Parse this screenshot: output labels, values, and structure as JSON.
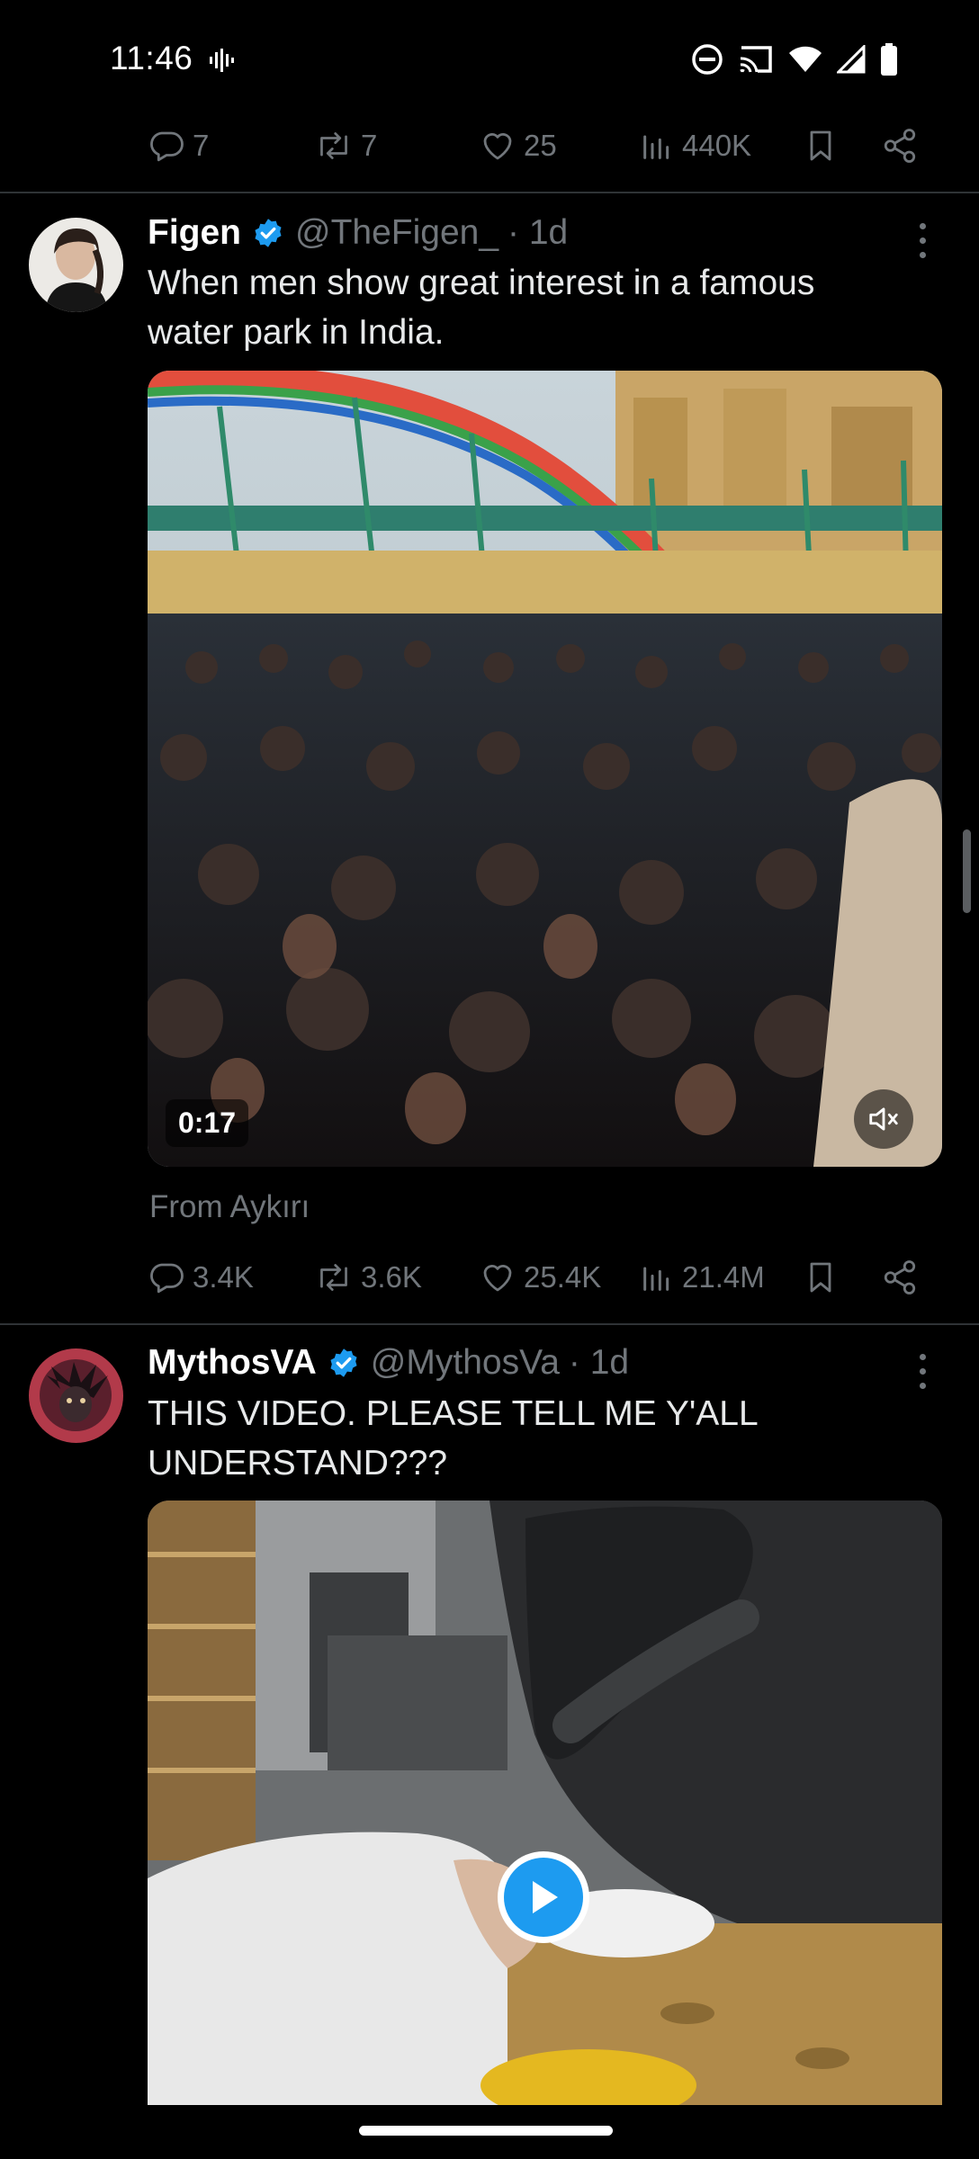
{
  "status_bar": {
    "time": "11:46",
    "icons": [
      "voicemail-wave-icon",
      "dnd-icon",
      "cast-icon",
      "wifi-icon",
      "signal-icon",
      "battery-icon"
    ]
  },
  "top_actions": {
    "replies": "7",
    "reposts": "7",
    "likes": "25",
    "views": "440K"
  },
  "tweets": [
    {
      "author_name": "Figen",
      "handle": "@TheFigen_",
      "time": "· 1d",
      "verified": true,
      "text_line1": "When men show great interest in a famous",
      "text_line2": "water park in India.",
      "media": {
        "type": "video",
        "duration": "0:17",
        "muted": true
      },
      "source": "From Aykırı",
      "replies": "3.4K",
      "reposts": "3.6K",
      "likes": "25.4K",
      "views": "21.4M"
    },
    {
      "author_name": "MythosVA",
      "handle": "@MythosVa",
      "time": "· 1d",
      "verified": true,
      "text_line1": "THIS VIDEO. PLEASE TELL ME Y'ALL",
      "text_line2": "UNDERSTAND???",
      "media": {
        "type": "video",
        "state": "paused"
      }
    }
  ],
  "colors": {
    "background": "#000000",
    "text": "#e7e9ea",
    "muted": "#71767b",
    "accent": "#1d9bf0",
    "divider": "#2f3336"
  }
}
